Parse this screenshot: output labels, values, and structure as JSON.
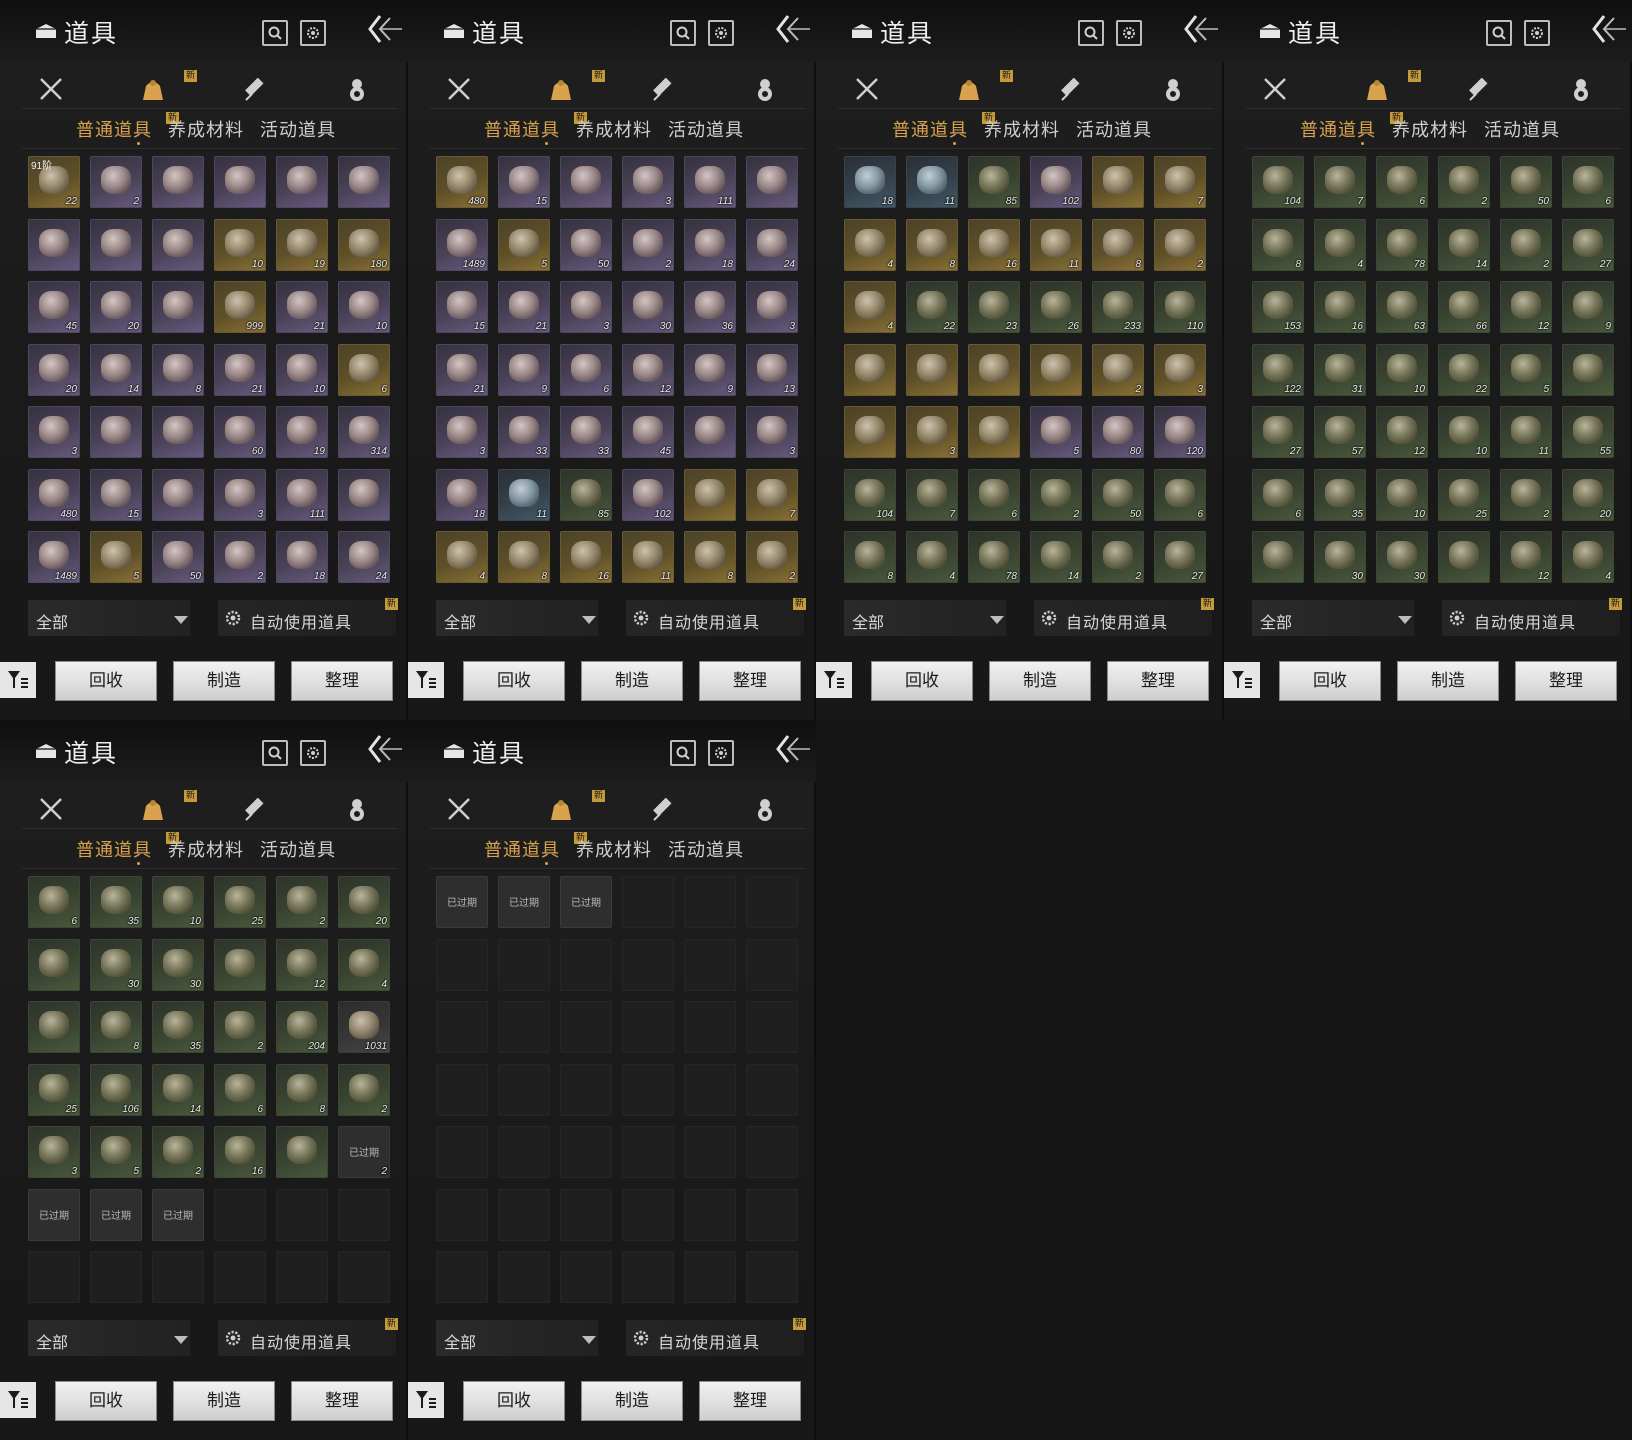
{
  "header": {
    "title": "道具"
  },
  "category_badge": "新",
  "subtabs": [
    "普通道具",
    "养成材料",
    "活动道具"
  ],
  "subtab_badge": "新",
  "footer": {
    "filter_value": "全部",
    "auto_use_label": "自动使用道具",
    "auto_badge": "新"
  },
  "buttons": {
    "recycle": "回收",
    "craft": "制造",
    "sort": "整理"
  },
  "expired_label": "已过期",
  "panels": [
    {
      "items": [
        [
          "gold",
          "22",
          "91阶"
        ],
        [
          "purple",
          "2"
        ],
        [
          "purple",
          ""
        ],
        [
          "purple",
          ""
        ],
        [
          "purple",
          ""
        ],
        [
          "purple",
          ""
        ],
        [
          "purple",
          ""
        ],
        [
          "purple",
          ""
        ],
        [
          "purple",
          ""
        ],
        [
          "gold",
          "10"
        ],
        [
          "gold",
          "19"
        ],
        [
          "gold",
          "180"
        ],
        [
          "purple",
          "45"
        ],
        [
          "purple",
          "20"
        ],
        [
          "purple",
          ""
        ],
        [
          "gold",
          "999"
        ],
        [
          "purple",
          "21"
        ],
        [
          "purple",
          "10"
        ],
        [
          "purple",
          "20"
        ],
        [
          "purple",
          "14"
        ],
        [
          "purple",
          "8"
        ],
        [
          "purple",
          "21"
        ],
        [
          "purple",
          "10"
        ],
        [
          "gold",
          "6"
        ],
        [
          "purple",
          "3"
        ],
        [
          "purple",
          ""
        ],
        [
          "purple",
          ""
        ],
        [
          "purple",
          "60"
        ],
        [
          "purple",
          "19"
        ],
        [
          "purple",
          "314"
        ],
        [
          "purple",
          "480"
        ],
        [
          "purple",
          "15"
        ],
        [
          "purple",
          ""
        ],
        [
          "purple",
          "3"
        ],
        [
          "purple",
          "111"
        ],
        [
          "purple",
          ""
        ],
        [
          "purple",
          "1489"
        ],
        [
          "gold",
          "5"
        ],
        [
          "purple",
          "50"
        ],
        [
          "purple",
          "2"
        ],
        [
          "purple",
          "18"
        ],
        [
          "purple",
          "24"
        ]
      ]
    },
    {
      "items": [
        [
          "gold",
          "480"
        ],
        [
          "purple",
          "15"
        ],
        [
          "purple",
          ""
        ],
        [
          "purple",
          "3"
        ],
        [
          "purple",
          "111"
        ],
        [
          "purple",
          ""
        ],
        [
          "purple",
          "1489"
        ],
        [
          "gold",
          "5"
        ],
        [
          "purple",
          "50"
        ],
        [
          "purple",
          "2"
        ],
        [
          "purple",
          "18"
        ],
        [
          "purple",
          "24"
        ],
        [
          "purple",
          "15"
        ],
        [
          "purple",
          "21"
        ],
        [
          "purple",
          "3"
        ],
        [
          "purple",
          "30"
        ],
        [
          "purple",
          "36"
        ],
        [
          "purple",
          "3"
        ],
        [
          "purple",
          "21"
        ],
        [
          "purple",
          "9"
        ],
        [
          "purple",
          "6"
        ],
        [
          "purple",
          "12"
        ],
        [
          "purple",
          "9"
        ],
        [
          "purple",
          "13"
        ],
        [
          "purple",
          "3"
        ],
        [
          "purple",
          "33"
        ],
        [
          "purple",
          "33"
        ],
        [
          "purple",
          "45"
        ],
        [
          "purple",
          ""
        ],
        [
          "purple",
          "3"
        ],
        [
          "purple",
          "18"
        ],
        [
          "blue",
          "11"
        ],
        [
          "green",
          "85"
        ],
        [
          "purple",
          "102"
        ],
        [
          "gold",
          ""
        ],
        [
          "gold",
          "7"
        ],
        [
          "gold",
          "4"
        ],
        [
          "gold",
          "8"
        ],
        [
          "gold",
          "16"
        ],
        [
          "gold",
          "11"
        ],
        [
          "gold",
          "8"
        ],
        [
          "gold",
          "2"
        ]
      ]
    },
    {
      "items": [
        [
          "blue",
          "18"
        ],
        [
          "blue",
          "11"
        ],
        [
          "green",
          "85"
        ],
        [
          "purple",
          "102"
        ],
        [
          "gold",
          ""
        ],
        [
          "gold",
          "7"
        ],
        [
          "gold",
          "4"
        ],
        [
          "gold",
          "8"
        ],
        [
          "gold",
          "16"
        ],
        [
          "gold",
          "11"
        ],
        [
          "gold",
          "8"
        ],
        [
          "gold",
          "2"
        ],
        [
          "gold",
          "4"
        ],
        [
          "green",
          "22"
        ],
        [
          "green",
          "23"
        ],
        [
          "green",
          "26"
        ],
        [
          "green",
          "233"
        ],
        [
          "green",
          "110"
        ],
        [
          "gold",
          ""
        ],
        [
          "gold",
          ""
        ],
        [
          "gold",
          ""
        ],
        [
          "gold",
          ""
        ],
        [
          "gold",
          "2"
        ],
        [
          "gold",
          "3"
        ],
        [
          "gold",
          ""
        ],
        [
          "gold",
          "3"
        ],
        [
          "gold",
          ""
        ],
        [
          "purple",
          "5"
        ],
        [
          "purple",
          "80"
        ],
        [
          "purple",
          "120"
        ],
        [
          "green",
          "104"
        ],
        [
          "green",
          "7"
        ],
        [
          "green",
          "6"
        ],
        [
          "green",
          "2"
        ],
        [
          "green",
          "50"
        ],
        [
          "green",
          "6"
        ],
        [
          "green",
          "8"
        ],
        [
          "green",
          "4"
        ],
        [
          "green",
          "78"
        ],
        [
          "green",
          "14"
        ],
        [
          "green",
          "2"
        ],
        [
          "green",
          "27"
        ]
      ]
    },
    {
      "items": [
        [
          "green",
          "104"
        ],
        [
          "green",
          "7"
        ],
        [
          "green",
          "6"
        ],
        [
          "green",
          "2"
        ],
        [
          "green",
          "50"
        ],
        [
          "green",
          "6"
        ],
        [
          "green",
          "8"
        ],
        [
          "green",
          "4"
        ],
        [
          "green",
          "78"
        ],
        [
          "green",
          "14"
        ],
        [
          "green",
          "2"
        ],
        [
          "green",
          "27"
        ],
        [
          "green",
          "153"
        ],
        [
          "green",
          "16"
        ],
        [
          "green",
          "63"
        ],
        [
          "green",
          "66"
        ],
        [
          "green",
          "12"
        ],
        [
          "green",
          "9"
        ],
        [
          "green",
          "122"
        ],
        [
          "green",
          "31"
        ],
        [
          "green",
          "10"
        ],
        [
          "green",
          "22"
        ],
        [
          "green",
          "5"
        ],
        [
          "green",
          ""
        ],
        [
          "green",
          "27"
        ],
        [
          "green",
          "57"
        ],
        [
          "green",
          "12"
        ],
        [
          "green",
          "10"
        ],
        [
          "green",
          "11"
        ],
        [
          "green",
          "55"
        ],
        [
          "green",
          "6"
        ],
        [
          "green",
          "35"
        ],
        [
          "green",
          "10"
        ],
        [
          "green",
          "25"
        ],
        [
          "green",
          "2"
        ],
        [
          "green",
          "20"
        ],
        [
          "green",
          ""
        ],
        [
          "green",
          "30"
        ],
        [
          "green",
          "30"
        ],
        [
          "green",
          ""
        ],
        [
          "green",
          "12"
        ],
        [
          "green",
          "4"
        ]
      ]
    },
    {
      "items": [
        [
          "green",
          "6"
        ],
        [
          "green",
          "35"
        ],
        [
          "green",
          "10"
        ],
        [
          "green",
          "25"
        ],
        [
          "green",
          "2"
        ],
        [
          "green",
          "20"
        ],
        [
          "green",
          ""
        ],
        [
          "green",
          "30"
        ],
        [
          "green",
          "30"
        ],
        [
          "green",
          ""
        ],
        [
          "green",
          "12"
        ],
        [
          "green",
          "4"
        ],
        [
          "green",
          ""
        ],
        [
          "green",
          "8"
        ],
        [
          "green",
          "35"
        ],
        [
          "green",
          "2"
        ],
        [
          "green",
          "204"
        ],
        [
          "gray",
          "1031"
        ],
        [
          "green",
          "25"
        ],
        [
          "green",
          "106"
        ],
        [
          "green",
          "14"
        ],
        [
          "green",
          "6"
        ],
        [
          "green",
          "8"
        ],
        [
          "green",
          "2"
        ],
        [
          "green",
          "3"
        ],
        [
          "green",
          "5"
        ],
        [
          "green",
          "2"
        ],
        [
          "green",
          "16"
        ],
        [
          "green",
          ""
        ],
        [
          "expired",
          "2"
        ],
        [
          "expired",
          ""
        ],
        [
          "expired",
          ""
        ],
        [
          "expired",
          ""
        ],
        [
          "empty",
          ""
        ],
        [
          "empty",
          ""
        ],
        [
          "empty",
          ""
        ],
        [
          "empty",
          ""
        ],
        [
          "empty",
          ""
        ],
        [
          "empty",
          ""
        ],
        [
          "empty",
          ""
        ],
        [
          "empty",
          ""
        ],
        [
          "empty",
          ""
        ]
      ]
    },
    {
      "items": [
        [
          "expired",
          ""
        ],
        [
          "expired",
          ""
        ],
        [
          "expired",
          ""
        ],
        [
          "empty",
          ""
        ],
        [
          "empty",
          ""
        ],
        [
          "empty",
          ""
        ],
        [
          "empty",
          ""
        ],
        [
          "empty",
          ""
        ],
        [
          "empty",
          ""
        ],
        [
          "empty",
          ""
        ],
        [
          "empty",
          ""
        ],
        [
          "empty",
          ""
        ],
        [
          "empty",
          ""
        ],
        [
          "empty",
          ""
        ],
        [
          "empty",
          ""
        ],
        [
          "empty",
          ""
        ],
        [
          "empty",
          ""
        ],
        [
          "empty",
          ""
        ],
        [
          "empty",
          ""
        ],
        [
          "empty",
          ""
        ],
        [
          "empty",
          ""
        ],
        [
          "empty",
          ""
        ],
        [
          "empty",
          ""
        ],
        [
          "empty",
          ""
        ],
        [
          "empty",
          ""
        ],
        [
          "empty",
          ""
        ],
        [
          "empty",
          ""
        ],
        [
          "empty",
          ""
        ],
        [
          "empty",
          ""
        ],
        [
          "empty",
          ""
        ],
        [
          "empty",
          ""
        ],
        [
          "empty",
          ""
        ],
        [
          "empty",
          ""
        ],
        [
          "empty",
          ""
        ],
        [
          "empty",
          ""
        ],
        [
          "empty",
          ""
        ],
        [
          "empty",
          ""
        ],
        [
          "empty",
          ""
        ],
        [
          "empty",
          ""
        ],
        [
          "empty",
          ""
        ],
        [
          "empty",
          ""
        ],
        [
          "empty",
          ""
        ]
      ]
    }
  ]
}
